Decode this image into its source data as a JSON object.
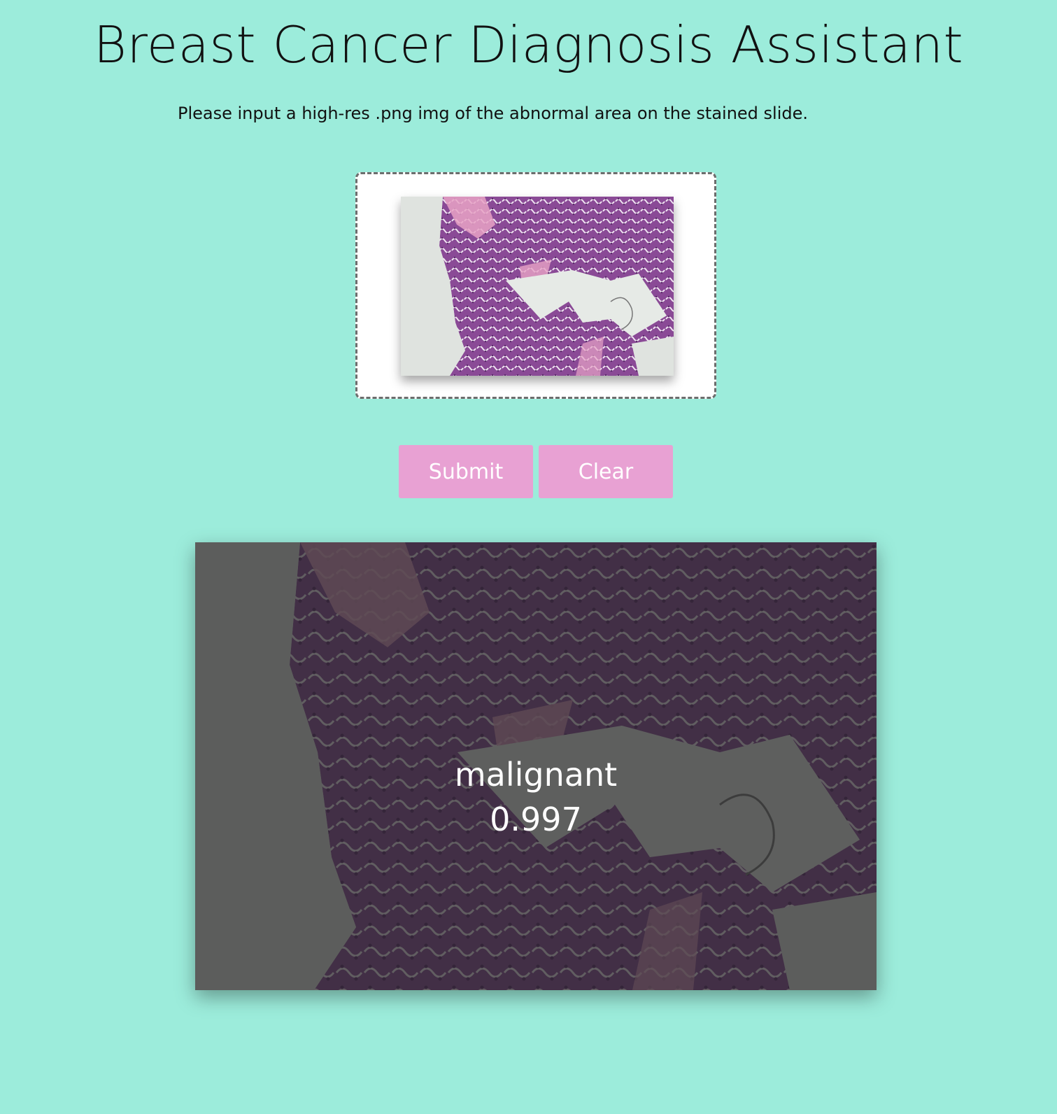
{
  "page": {
    "title": "Breast Cancer Diagnosis Assistant",
    "instruction": "Please input a high-res .png img of the abnormal area on the stained slide."
  },
  "upload": {
    "preview_image": "histology-slide-thumbnail"
  },
  "actions": {
    "submit_label": "Submit",
    "clear_label": "Clear"
  },
  "result": {
    "label": "malignant",
    "score": "0.997"
  },
  "colors": {
    "background": "#9cecdb",
    "button": "#e8a1d3",
    "tissue": "#8a4a96",
    "stroma": "#e7a2c6",
    "slide_background": "#dfe3df"
  }
}
